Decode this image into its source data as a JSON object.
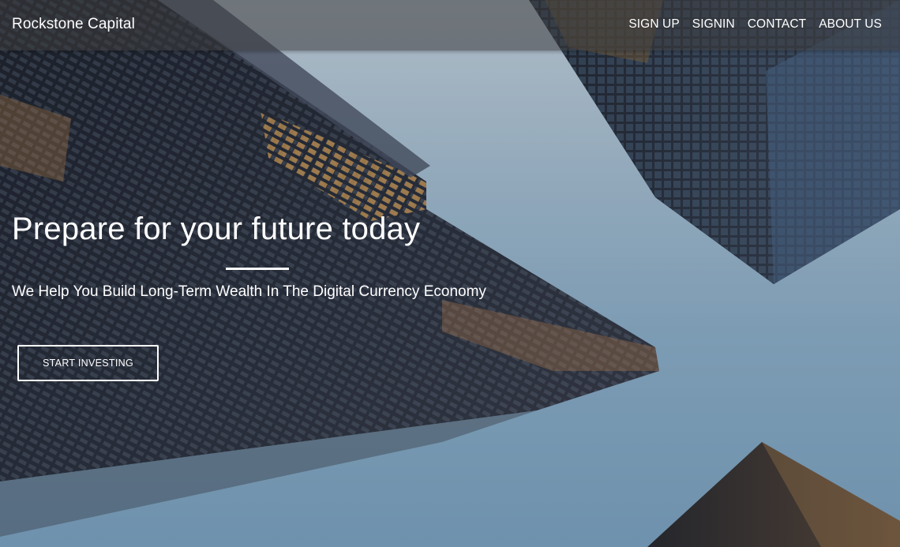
{
  "navbar": {
    "brand": "Rockstone Capital",
    "links": [
      {
        "label": "SIGN UP"
      },
      {
        "label": "SIGNIN"
      },
      {
        "label": "CONTACT"
      },
      {
        "label": "ABOUT US"
      }
    ]
  },
  "hero": {
    "headline": "Prepare for your future today",
    "subheadline": "We Help You Build Long-Term Wealth In The Digital Currency Economy",
    "cta_label": "START INVESTING",
    "background": "skyscrapers-photo"
  },
  "colors": {
    "text": "#ffffff",
    "navbar_bg": "#3c3c3e",
    "sky": "#8fb2cd"
  }
}
